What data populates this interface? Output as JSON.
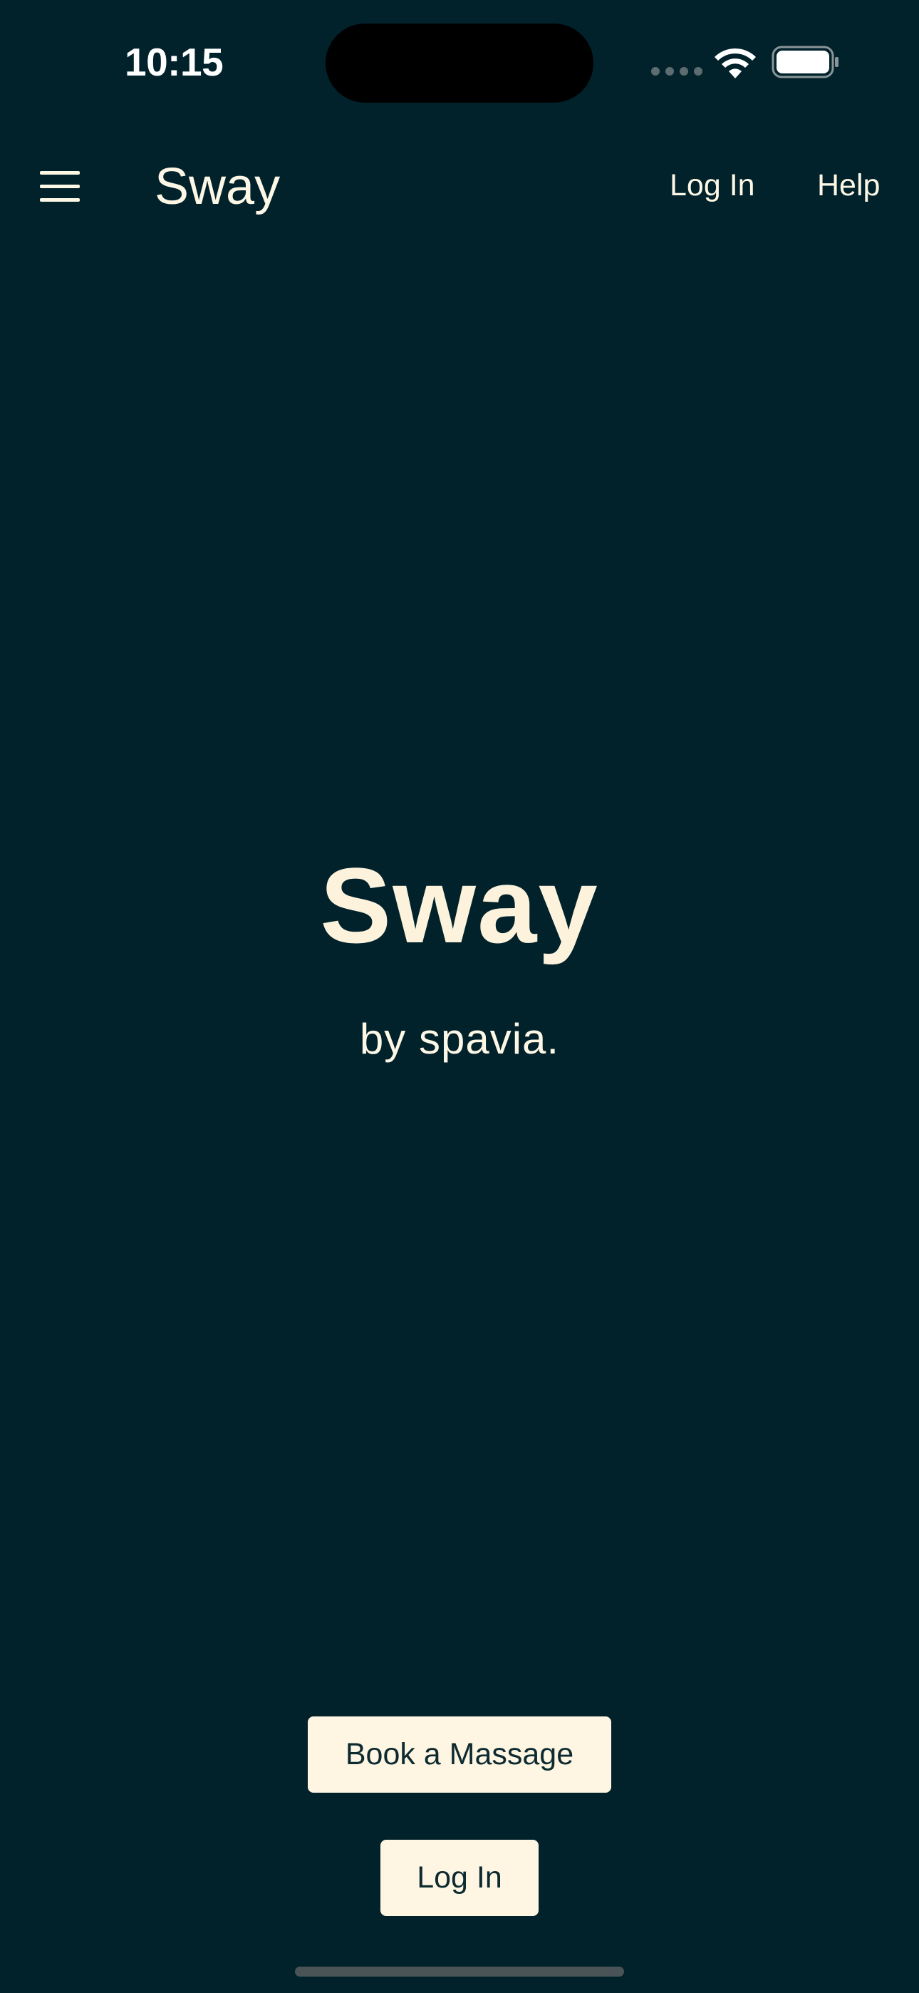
{
  "status_bar": {
    "time": "10:15"
  },
  "nav": {
    "title": "Sway",
    "login_label": "Log In",
    "help_label": "Help",
    "menu_icon": "hamburger-menu-icon"
  },
  "hero": {
    "title": "Sway",
    "subtitle": "by spavia."
  },
  "actions": {
    "book_label": "Book a Massage",
    "login_label": "Log In"
  },
  "colors": {
    "background": "#01222b",
    "foreground": "#fdf7e6",
    "button_background": "#fef6e3",
    "button_text": "#0d2a31"
  }
}
